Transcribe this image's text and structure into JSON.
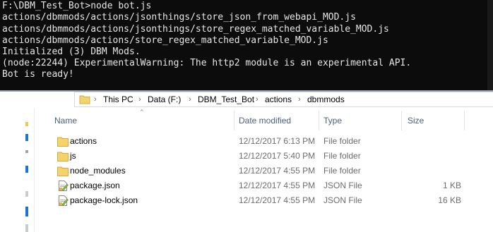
{
  "console": {
    "lines": [
      "F:\\DBM_Test_Bot>node bot.js",
      "actions/dbmmods/actions/jsonthings/store_json_from_webapi_MOD.js",
      "actions/dbmmods/actions/jsonthings/store_regex_matched_variable_MOD.js",
      "actions/dbmmods/actions/store_regex_matched_variable_MOD.js",
      "Initialized (3) DBM Mods.",
      "(node:22244) ExperimentalWarning: The http2 module is an experimental API.",
      "Bot is ready!"
    ]
  },
  "explorer": {
    "breadcrumb": [
      "This PC",
      "Data (F:)",
      "DBM_Test_Bot",
      "actions",
      "dbmmods"
    ],
    "columns": {
      "name": "Name",
      "date": "Date modified",
      "type": "Type",
      "size": "Size"
    },
    "rows": [
      {
        "name": "actions",
        "date": "12/12/2017 6:13 PM",
        "type": "File folder",
        "size": "",
        "icon": "folder-icon"
      },
      {
        "name": "js",
        "date": "12/12/2017 5:40 PM",
        "type": "File folder",
        "size": "",
        "icon": "folder-icon"
      },
      {
        "name": "node_modules",
        "date": "12/12/2017 4:55 PM",
        "type": "File folder",
        "size": "",
        "icon": "folder-icon"
      },
      {
        "name": "package.json",
        "date": "12/12/2017 4:55 PM",
        "type": "JSON File",
        "size": "1 KB",
        "icon": "json-file-icon"
      },
      {
        "name": "package-lock.json",
        "date": "12/12/2017 4:55 PM",
        "type": "JSON File",
        "size": "16 KB",
        "icon": "json-file-icon"
      }
    ]
  },
  "colors": {
    "console_bg": "#0c0c0c",
    "console_text": "#e6e6e6",
    "folder": "#f5d26b",
    "header_text": "#4c607a",
    "accent": "#1e74d6"
  }
}
